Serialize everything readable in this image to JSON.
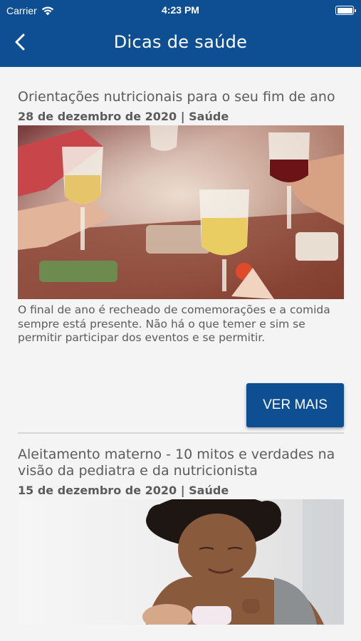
{
  "status_bar": {
    "carrier": "Carrier",
    "time": "4:23 PM"
  },
  "header": {
    "title": "Dicas de saúde",
    "back_icon": "chevron-left-icon"
  },
  "colors": {
    "brand": "#0d4f92",
    "text": "#5b5b5b",
    "background": "#f4f4f4"
  },
  "articles": [
    {
      "title": "Orientações nutricionais para o seu fim de ano",
      "date": "28 de dezembro de 2020 | Saúde",
      "description": "O final de ano é recheado de comemorações e a comida sempre está presente. Não há o que temer e sim se permitir participar dos eventos e se permitir.",
      "button_label": "VER MAIS"
    },
    {
      "title": "Aleitamento materno - 10 mitos e verdades na visão da pediatra e da nutricionista",
      "date": "15 de dezembro de 2020 | Saúde"
    }
  ]
}
